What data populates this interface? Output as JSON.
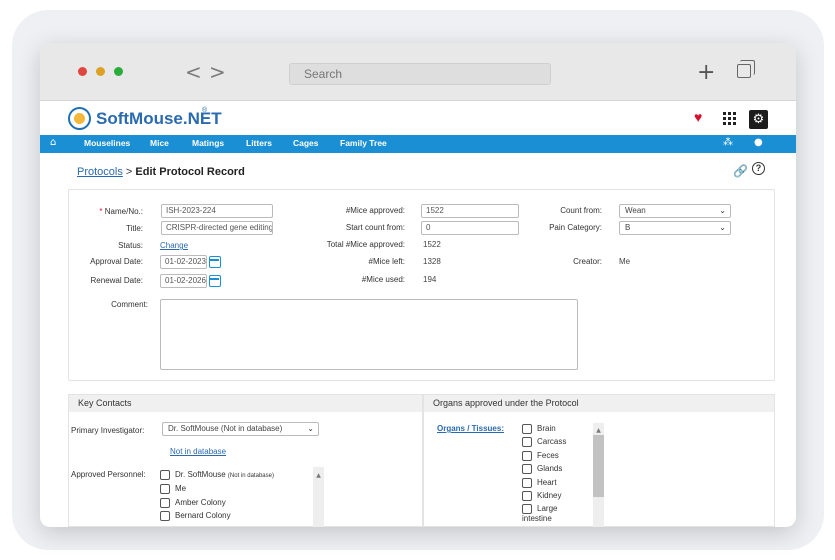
{
  "browser": {
    "search_placeholder": "Search",
    "back_glyph": "<",
    "forward_glyph": ">",
    "new_tab_glyph": "+"
  },
  "app": {
    "logo_soft": "SoftMouse",
    "logo_net": ".NET",
    "logo_reg": "®"
  },
  "menu": {
    "items": [
      "Mouselines",
      "Mice",
      "Matings",
      "Litters",
      "Cages",
      "Family Tree"
    ]
  },
  "breadcrumb": {
    "parent": "Protocols",
    "separator": " > ",
    "current": "Edit Protocol Record"
  },
  "form": {
    "name_label": "Name/No.:",
    "name_value": "ISH-2023-224",
    "title_label": "Title:",
    "title_value": "CRISPR-directed gene editing",
    "status_label": "Status:",
    "status_link": "Change",
    "approval_label": "Approval Date:",
    "approval_value": "01-02-2023",
    "renewal_label": "Renewal Date:",
    "renewal_value": "01-02-2026",
    "comment_label": "Comment:",
    "mice_approved_label": "#Mice approved:",
    "mice_approved_value": "1522",
    "start_count_label": "Start count from:",
    "start_count_value": "0",
    "total_mice_label": "Total #Mice approved:",
    "total_mice_value": "1522",
    "mice_left_label": "#Mice left:",
    "mice_left_value": "1328",
    "mice_used_label": "#Mice used:",
    "mice_used_value": "194",
    "count_from_label": "Count from:",
    "count_from_value": "Wean",
    "pain_label": "Pain Category:",
    "pain_value": "B",
    "creator_label": "Creator:",
    "creator_value": "Me"
  },
  "contacts": {
    "heading": "Key Contacts",
    "pi_label": "Primary Investigator:",
    "pi_value": "Dr. SoftMouse (Not in database)",
    "not_in_db_link": "Not in database",
    "personnel_label": "Approved Personnel:",
    "personnel": [
      {
        "name": "Dr. SoftMouse",
        "note": "(Not in database)"
      },
      {
        "name": "Me",
        "note": ""
      },
      {
        "name": "Amber Colony",
        "note": ""
      },
      {
        "name": "Bernard Colony",
        "note": ""
      }
    ]
  },
  "organs": {
    "heading": "Organs approved under the Protocol",
    "link": "Organs / Tissues:",
    "items": [
      "Brain",
      "Carcass",
      "Feces",
      "Glands",
      "Heart",
      "Kidney",
      "Large intestine"
    ]
  },
  "colors": {
    "brand_blue": "#1b8fd3",
    "link_blue": "#2a6ab0",
    "heart_red": "#d8102e"
  }
}
